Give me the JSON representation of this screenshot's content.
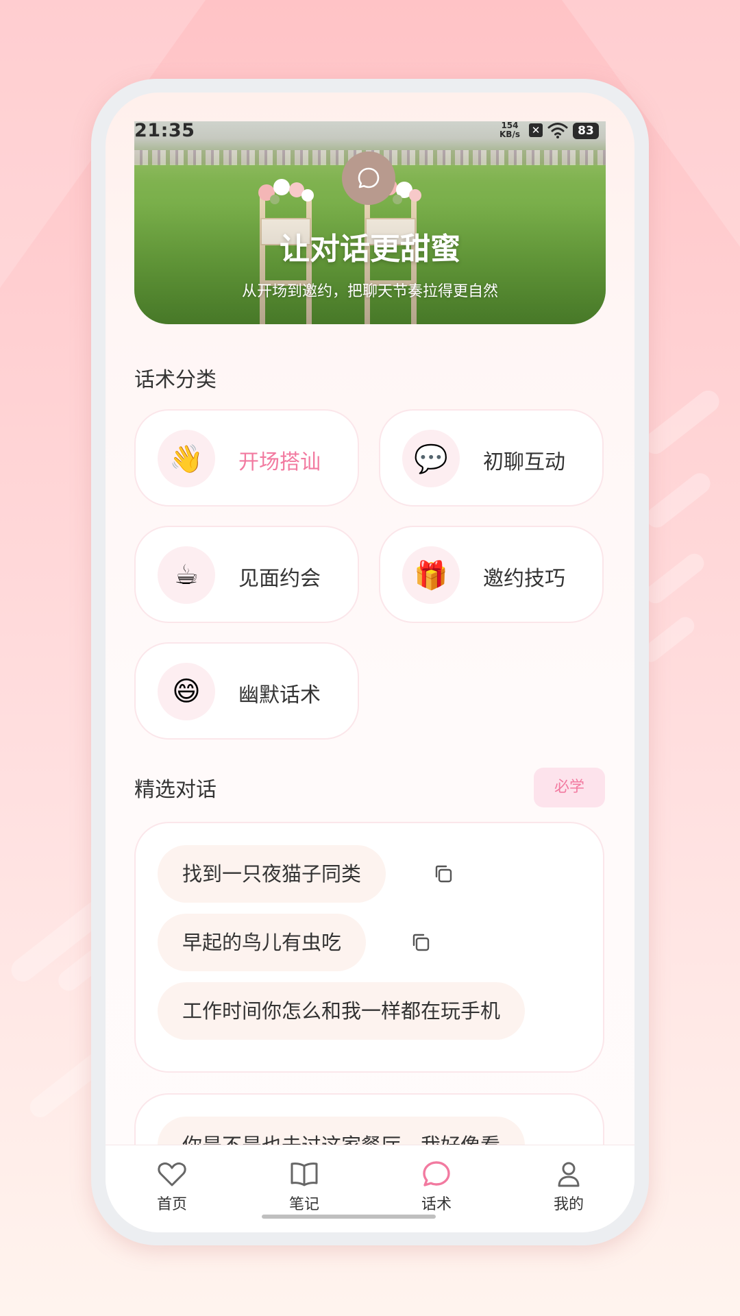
{
  "status_bar": {
    "time": "21:35",
    "net_speed_value": "154",
    "net_speed_unit": "KB/s",
    "battery": "83"
  },
  "banner": {
    "title": "让对话更甜蜜",
    "subtitle": "从开场到邀约，把聊天节奏拉得更自然"
  },
  "categories_section": {
    "title": "话术分类",
    "items": [
      {
        "label": "开场搭讪",
        "emoji": "👋",
        "active": true
      },
      {
        "label": "初聊互动",
        "emoji": "💬",
        "active": false
      },
      {
        "label": "见面约会",
        "emoji": "☕",
        "active": false
      },
      {
        "label": "邀约技巧",
        "emoji": "🎁",
        "active": false
      },
      {
        "label": "幽默话术",
        "emoji": "😄",
        "active": false
      }
    ]
  },
  "featured_section": {
    "title": "精选对话",
    "badge": "必学",
    "card1": {
      "lines": [
        "找到一只夜猫子同类",
        "早起的鸟儿有虫吃",
        "工作时间你怎么和我一样都在玩手机"
      ]
    },
    "card2": {
      "lines": [
        "你是不是也去过这家餐厅，我好像看"
      ]
    }
  },
  "bottom_nav": {
    "items": [
      {
        "label": "首页",
        "icon": "heart-icon"
      },
      {
        "label": "笔记",
        "icon": "book-icon"
      },
      {
        "label": "话术",
        "icon": "chat-icon",
        "active": true
      },
      {
        "label": "我的",
        "icon": "person-icon"
      }
    ]
  },
  "colors": {
    "accent": "#f27aa0",
    "background_top": "#ffc3c6",
    "card_border": "#fbe6ea"
  }
}
